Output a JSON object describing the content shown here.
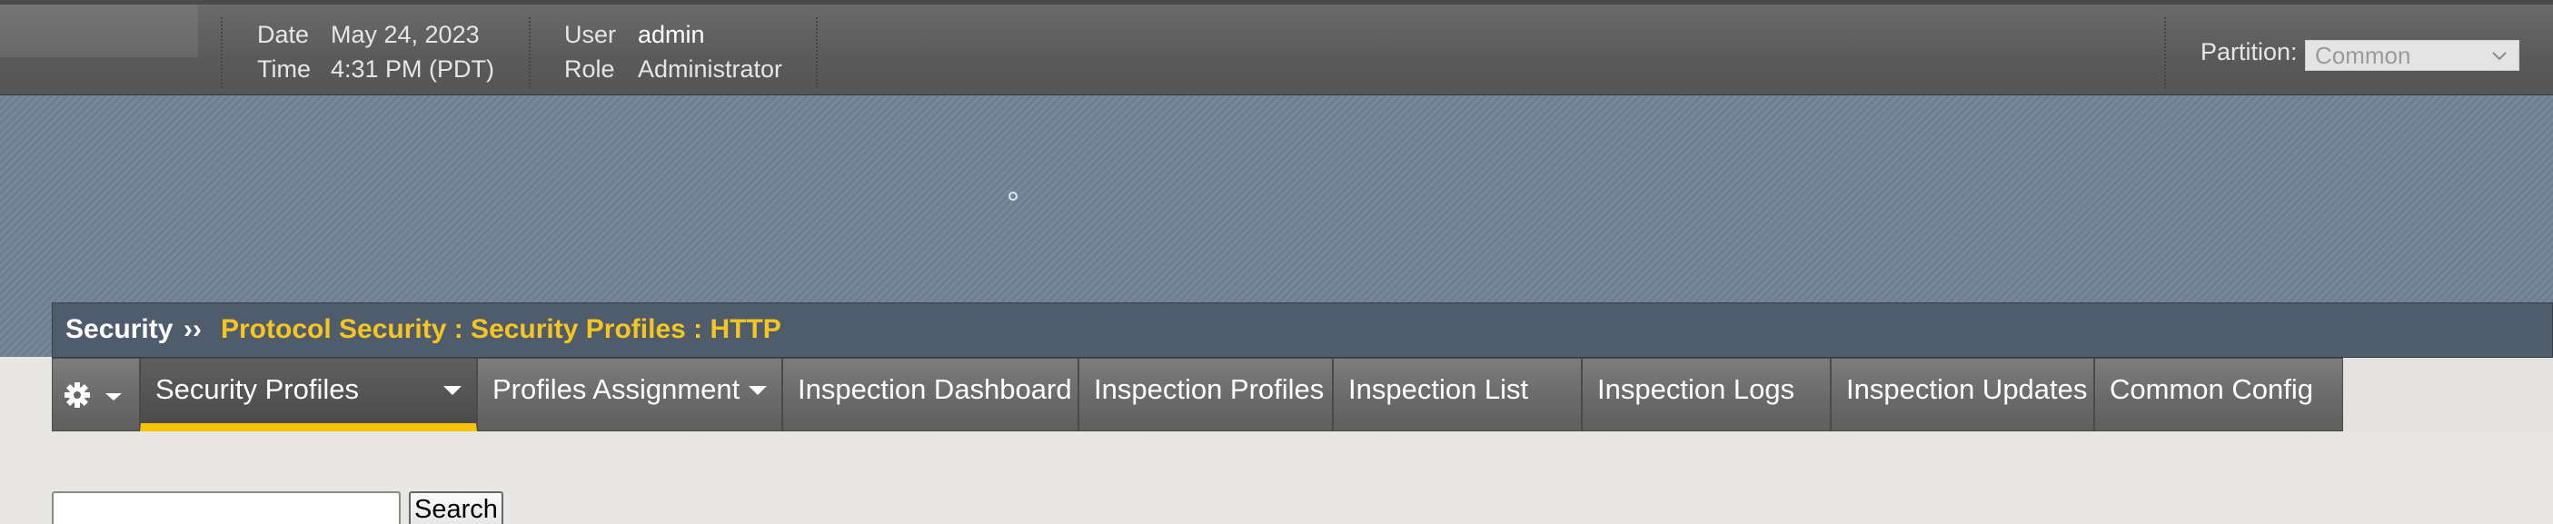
{
  "header": {
    "date_label": "Date",
    "date_value": "May 24, 2023",
    "time_label": "Time",
    "time_value": "4:31 PM (PDT)",
    "user_label": "User",
    "user_value": "admin",
    "role_label": "Role",
    "role_value": "Administrator",
    "partition_label": "Partition:",
    "partition_value": "Common"
  },
  "breadcrumb": {
    "root": "Security",
    "separator": "››",
    "path": "Protocol Security : Security Profiles : HTTP"
  },
  "tabs": [
    {
      "label": "Security Profiles",
      "active": true,
      "has_dropdown": true
    },
    {
      "label": "Profiles Assignment",
      "active": false,
      "has_dropdown": true
    },
    {
      "label": "Inspection Dashboard",
      "active": false,
      "has_dropdown": false
    },
    {
      "label": "Inspection Profiles",
      "active": false,
      "has_dropdown": false
    },
    {
      "label": "Inspection List",
      "active": false,
      "has_dropdown": false
    },
    {
      "label": "Inspection Logs",
      "active": false,
      "has_dropdown": false
    },
    {
      "label": "Inspection Updates",
      "active": false,
      "has_dropdown": false
    },
    {
      "label": "Common Config",
      "active": false,
      "has_dropdown": false
    }
  ],
  "settings_menu": {
    "icon": "gear-icon"
  },
  "search": {
    "input_value": "",
    "button_label": "Search"
  },
  "colors": {
    "breadcrumb_path": "#f7c521",
    "active_tab_underline": "#f5c300",
    "banner": "#728397"
  }
}
